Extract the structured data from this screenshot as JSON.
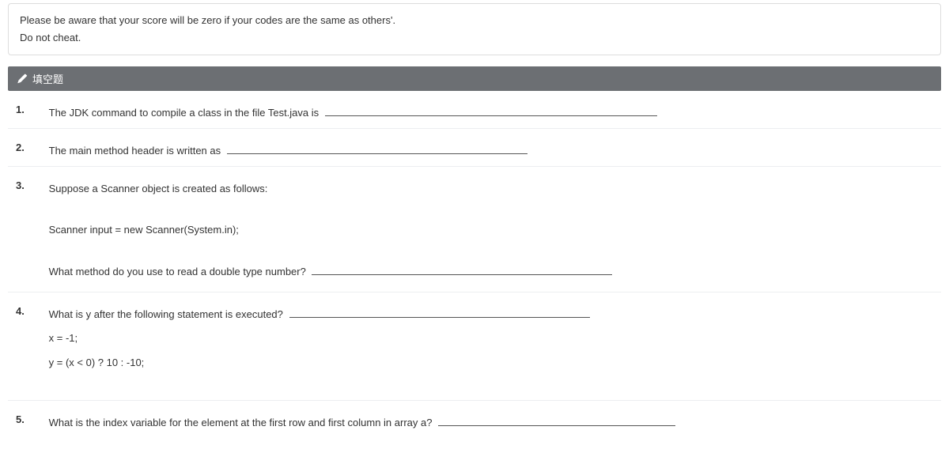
{
  "notice": {
    "line1": "Please be aware that your score will be zero if your codes are  the same as others'.",
    "line2": "Do not cheat."
  },
  "section_title": "填空题",
  "questions": [
    {
      "num": "1.",
      "text_before": "The JDK command to compile a class in the file Test.java is",
      "blank_class": "w-long"
    },
    {
      "num": "2.",
      "text_before": "The main method header is written as",
      "blank_class": "w-med"
    },
    {
      "num": "3.",
      "para1": "Suppose a Scanner object is created as follows:",
      "para2": "Scanner input = new Scanner(System.in);",
      "para3_before": "What method do you use to read a double type number?",
      "blank_class": "w-med"
    },
    {
      "num": "4.",
      "line1_before": "What is y after the following statement is executed?",
      "blank_class": "w-med",
      "line2": "x = -1;",
      "line3": "y = (x < 0) ? 10 : -10;"
    },
    {
      "num": "5.",
      "text_before": "What is the index variable for the element at the first row and first column in array a?",
      "blank_class": "w-short"
    }
  ]
}
